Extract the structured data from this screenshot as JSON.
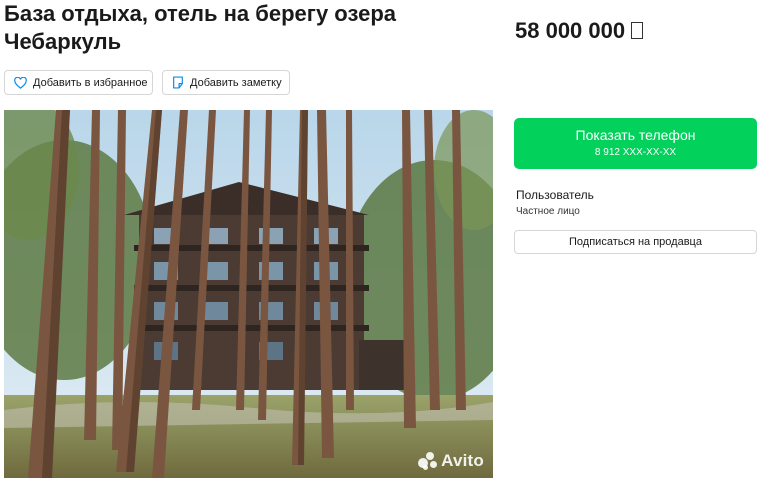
{
  "listing": {
    "title": "База отдыха, отель на берегу озера Чебаркуль",
    "price": "58 000 000",
    "currency_icon": "ruble-sign-placeholder-icon"
  },
  "actions": {
    "favorite_label": "Добавить в избранное",
    "favorite_icon": "heart-icon",
    "note_label": "Добавить заметку",
    "note_icon": "note-icon"
  },
  "photo": {
    "watermark": "Avito",
    "colors": {
      "sky": "#cfe3ef",
      "grass": "#8a9a52",
      "trunk": "#6b4a36",
      "building": "#4a3a32"
    }
  },
  "contact": {
    "show_phone_label": "Показать телефон",
    "phone_mask": "8 912 XXX-XX-XX",
    "accent_color": "#02d15c"
  },
  "seller": {
    "name": "Пользователь",
    "type": "Частное лицо",
    "subscribe_label": "Подписаться на продавца"
  }
}
